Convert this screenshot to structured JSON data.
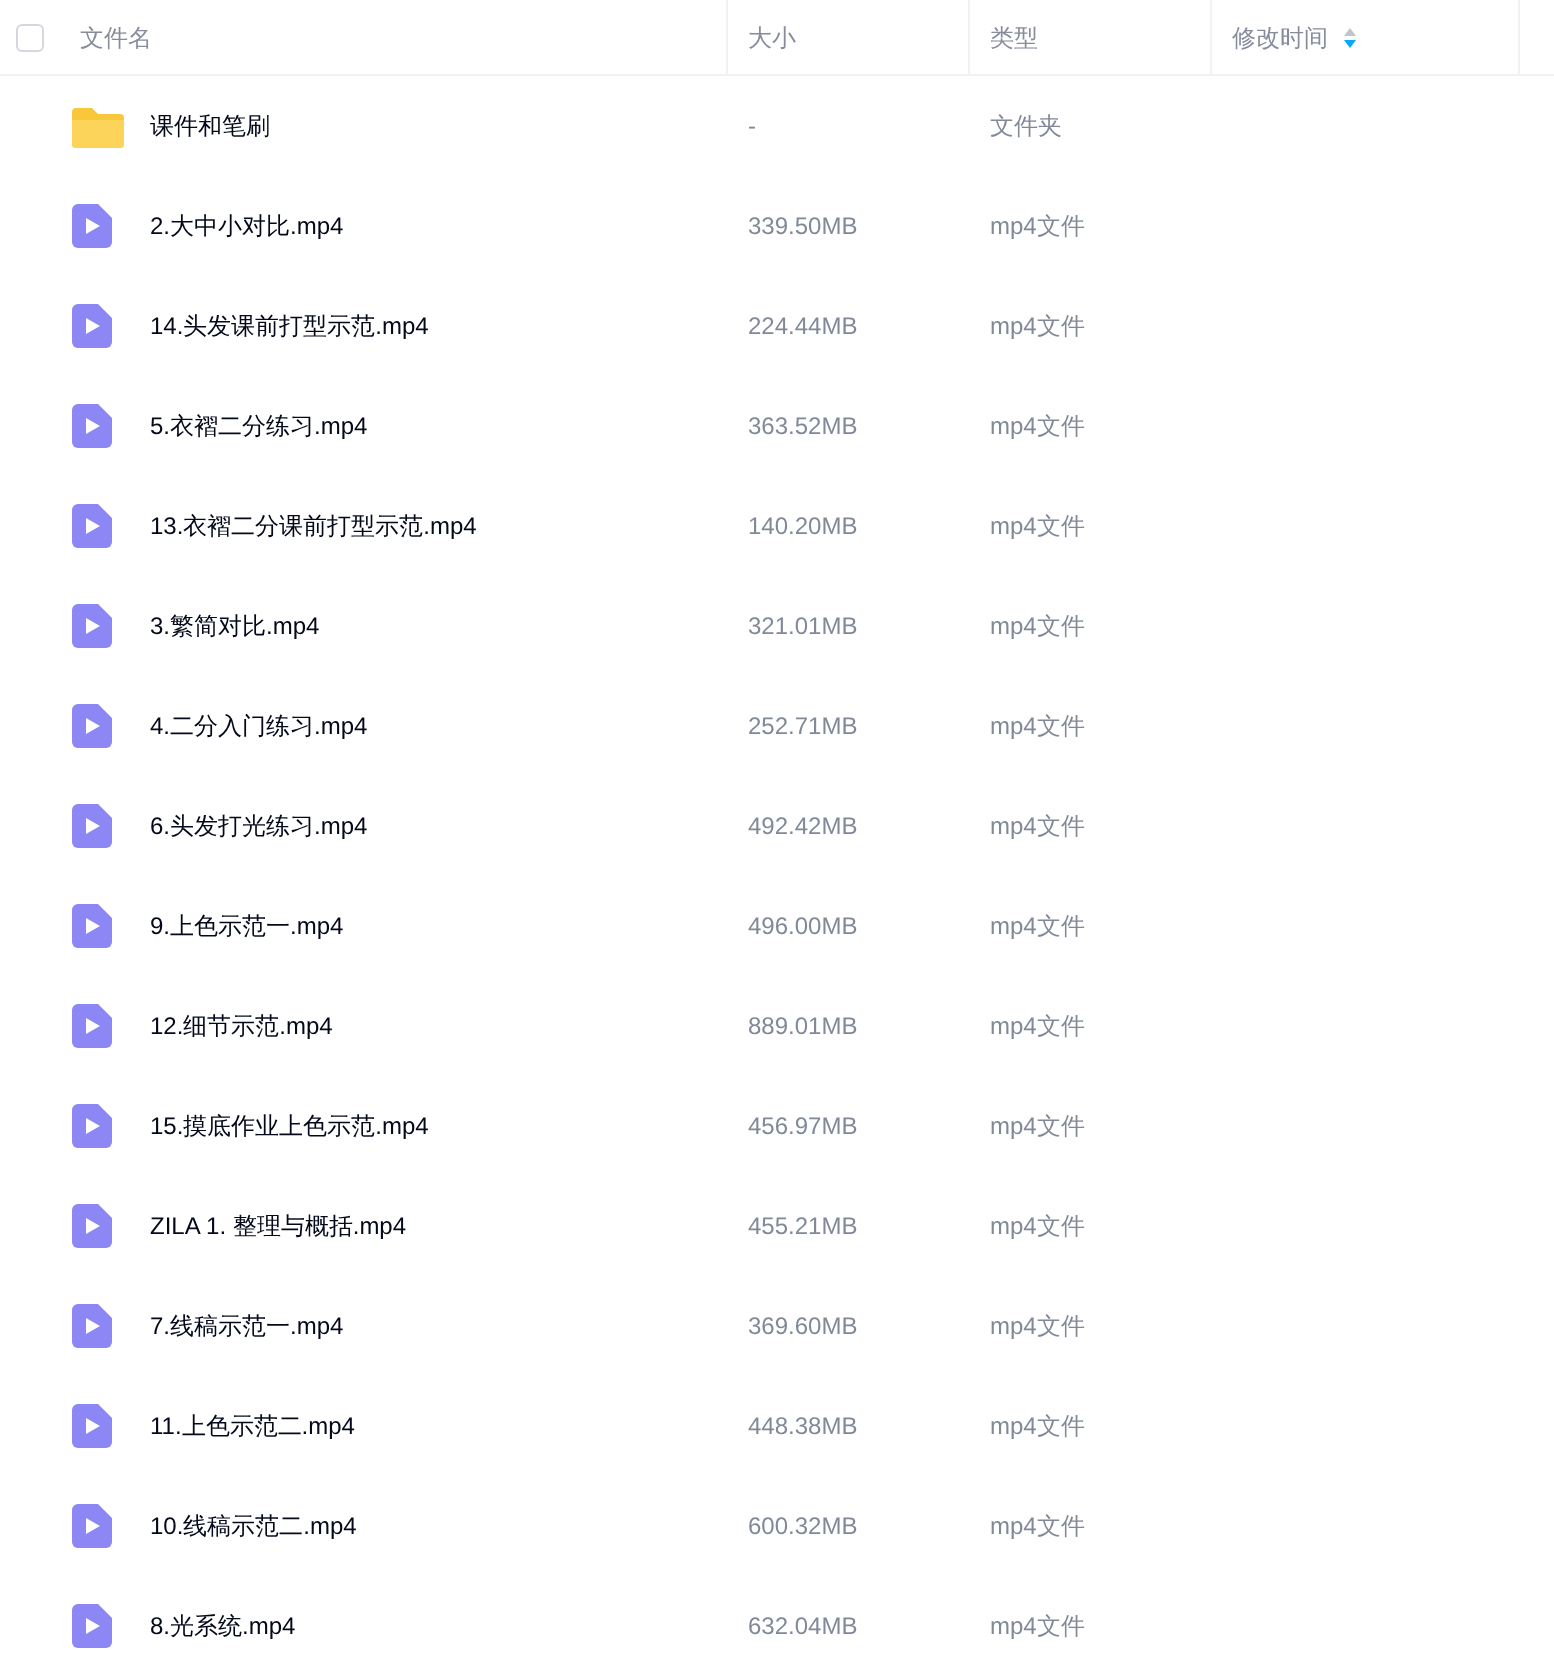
{
  "header": {
    "select_all": {
      "checked": false
    },
    "columns": [
      {
        "label": "文件名"
      },
      {
        "label": "大小"
      },
      {
        "label": "类型"
      },
      {
        "label": "修改时间",
        "sorted_descending": true
      }
    ]
  },
  "rows": [
    {
      "kind": "folder",
      "name": "课件和笔刷",
      "size": "-",
      "type": "文件夹"
    },
    {
      "kind": "video",
      "name": "2.大中小对比.mp4",
      "size": "339.50MB",
      "type": "mp4文件"
    },
    {
      "kind": "video",
      "name": "14.头发课前打型示范.mp4",
      "size": "224.44MB",
      "type": "mp4文件"
    },
    {
      "kind": "video",
      "name": "5.衣褶二分练习.mp4",
      "size": "363.52MB",
      "type": "mp4文件"
    },
    {
      "kind": "video",
      "name": "13.衣褶二分课前打型示范.mp4",
      "size": "140.20MB",
      "type": "mp4文件"
    },
    {
      "kind": "video",
      "name": "3.繁简对比.mp4",
      "size": "321.01MB",
      "type": "mp4文件"
    },
    {
      "kind": "video",
      "name": "4.二分入门练习.mp4",
      "size": "252.71MB",
      "type": "mp4文件"
    },
    {
      "kind": "video",
      "name": "6.头发打光练习.mp4",
      "size": "492.42MB",
      "type": "mp4文件"
    },
    {
      "kind": "video",
      "name": "9.上色示范一.mp4",
      "size": "496.00MB",
      "type": "mp4文件"
    },
    {
      "kind": "video",
      "name": "12.细节示范.mp4",
      "size": "889.01MB",
      "type": "mp4文件"
    },
    {
      "kind": "video",
      "name": "15.摸底作业上色示范.mp4",
      "size": "456.97MB",
      "type": "mp4文件"
    },
    {
      "kind": "video",
      "name": "ZILA 1. 整理与概括.mp4",
      "size": "455.21MB",
      "type": "mp4文件"
    },
    {
      "kind": "video",
      "name": "7.线稿示范一.mp4",
      "size": "369.60MB",
      "type": "mp4文件"
    },
    {
      "kind": "video",
      "name": "11.上色示范二.mp4",
      "size": "448.38MB",
      "type": "mp4文件"
    },
    {
      "kind": "video",
      "name": "10.线稿示范二.mp4",
      "size": "600.32MB",
      "type": "mp4文件"
    },
    {
      "kind": "video",
      "name": "8.光系统.mp4",
      "size": "632.04MB",
      "type": "mp4文件"
    }
  ]
}
